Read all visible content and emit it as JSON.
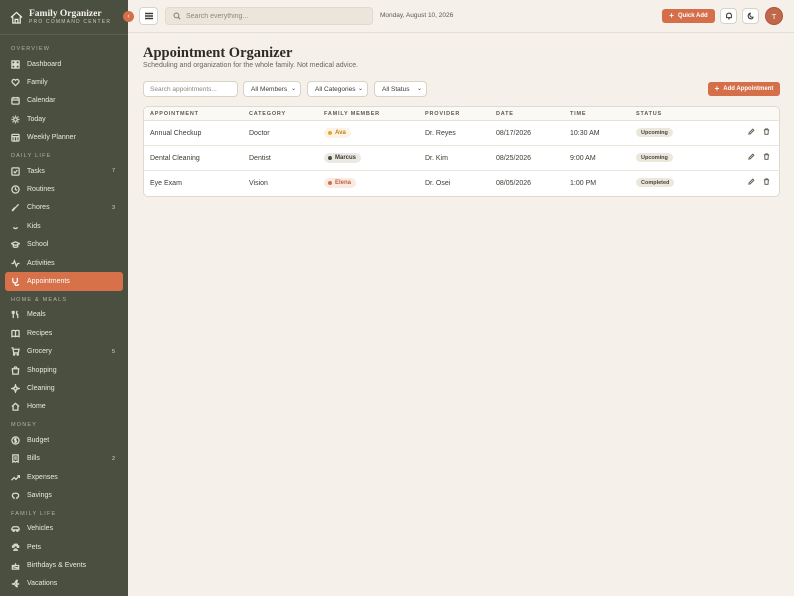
{
  "brand": {
    "title": "Family Organizer",
    "subtitle": "PRO COMMAND CENTER",
    "collapse_glyph": "‹"
  },
  "topbar": {
    "search_placeholder": "Search everything...",
    "date": "Monday, August 10, 2026",
    "quick_add": "Quick Add",
    "avatar_initial": "T"
  },
  "sidebar": {
    "sections": [
      {
        "label": "OVERVIEW"
      },
      {
        "label": "DAILY LIFE"
      },
      {
        "label": "HOME & MEALS"
      },
      {
        "label": "MONEY"
      },
      {
        "label": "FAMILY LIFE"
      }
    ],
    "items": [
      {
        "label": "Dashboard"
      },
      {
        "label": "Family"
      },
      {
        "label": "Calendar"
      },
      {
        "label": "Today"
      },
      {
        "label": "Weekly Planner"
      },
      {
        "label": "Tasks",
        "badge": "7"
      },
      {
        "label": "Routines"
      },
      {
        "label": "Chores",
        "badge": "3"
      },
      {
        "label": "Kids"
      },
      {
        "label": "School"
      },
      {
        "label": "Activities"
      },
      {
        "label": "Appointments"
      },
      {
        "label": "Meals"
      },
      {
        "label": "Recipes"
      },
      {
        "label": "Grocery",
        "badge": "5"
      },
      {
        "label": "Shopping"
      },
      {
        "label": "Cleaning"
      },
      {
        "label": "Home"
      },
      {
        "label": "Budget"
      },
      {
        "label": "Bills",
        "badge": "2"
      },
      {
        "label": "Expenses"
      },
      {
        "label": "Savings"
      },
      {
        "label": "Vehicles"
      },
      {
        "label": "Pets"
      },
      {
        "label": "Birthdays & Events"
      },
      {
        "label": "Vacations"
      }
    ]
  },
  "main": {
    "title": "Appointment Organizer",
    "subtitle": "Scheduling and organization for the whole family. Not medical advice.",
    "filter_placeholder": "Search appointments...",
    "filters": {
      "members": "All Members",
      "categories": "All Categories",
      "status": "All Status"
    },
    "add_button": "Add Appointment",
    "columns": [
      "APPOINTMENT",
      "CATEGORY",
      "FAMILY MEMBER",
      "PROVIDER",
      "DATE",
      "TIME",
      "STATUS"
    ],
    "rows": [
      {
        "appointment": "Annual Checkup",
        "category": "Doctor",
        "member": "Ava",
        "provider": "Dr. Reyes",
        "date": "08/17/2026",
        "time": "10:30 AM",
        "status": "Upcoming"
      },
      {
        "appointment": "Dental Cleaning",
        "category": "Dentist",
        "member": "Marcus",
        "provider": "Dr. Kim",
        "date": "08/25/2026",
        "time": "9:00 AM",
        "status": "Upcoming"
      },
      {
        "appointment": "Eye Exam",
        "category": "Vision",
        "member": "Elena",
        "provider": "Dr. Osei",
        "date": "08/05/2026",
        "time": "1:00 PM",
        "status": "Completed"
      }
    ]
  },
  "colors": {
    "accent": "#d46f4a",
    "sidebar_bg": "#4a4f40",
    "page_bg": "#f5f1ea",
    "ava": "#e8a33d",
    "marcus": "#4a4f40",
    "elena": "#d46f4a"
  }
}
